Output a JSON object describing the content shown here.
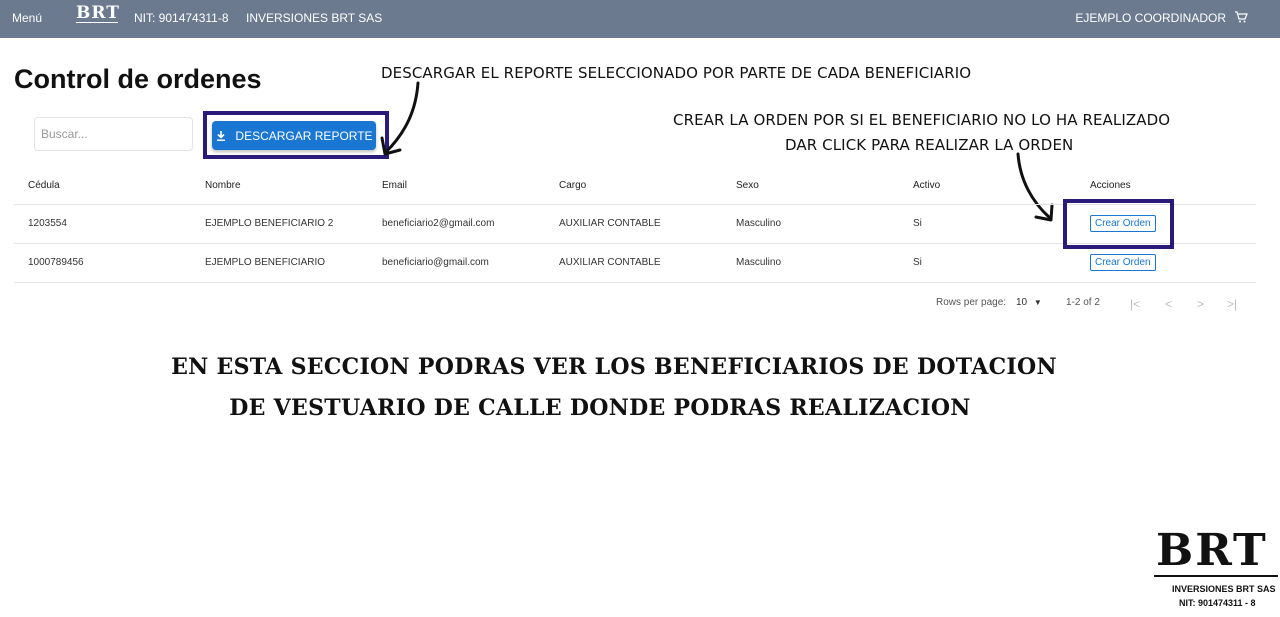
{
  "topbar": {
    "menu_label": "Menú",
    "logo_text": "BRT",
    "nit": "NIT: 901474311-8",
    "company": "INVERSIONES BRT SAS",
    "user": "EJEMPLO COORDINADOR",
    "cart_icon": "cart-icon",
    "background": "#6b7a8f"
  },
  "page": {
    "title": "Control de ordenes"
  },
  "search": {
    "placeholder": "Buscar..."
  },
  "toolbar": {
    "download_label": "DESCARGAR REPORTE",
    "download_icon": "download-icon",
    "accent": "#1976d2"
  },
  "annotations": {
    "download_note": "DESCARGAR EL REPORTE SELECCIONADO POR PARTE DE CADA BENEFICIARIO",
    "create_note_line1": "CREAR LA ORDEN POR SI EL BENEFICIARIO NO LO HA REALIZADO",
    "create_note_line2": "DAR CLICK PARA REALIZAR LA ORDEN",
    "highlight_color": "#2a1a7a"
  },
  "table": {
    "headers": [
      "Cédula",
      "Nombre",
      "Email",
      "Cargo",
      "Sexo",
      "Activo",
      "Acciones"
    ],
    "rows": [
      {
        "cedula": "1203554",
        "nombre": "EJEMPLO BENEFICIARIO 2",
        "email": "beneficiario2@gmail.com",
        "cargo": "AUXILIAR CONTABLE",
        "sexo": "Masculino",
        "activo": "Si",
        "accion": "Crear Orden"
      },
      {
        "cedula": "1000789456",
        "nombre": "EJEMPLO BENEFICIARIO",
        "email": "beneficiario@gmail.com",
        "cargo": "AUXILIAR CONTABLE",
        "sexo": "Masculino",
        "activo": "Si",
        "accion": "Crear Orden"
      }
    ]
  },
  "pagination": {
    "rows_per_page_label": "Rows per page:",
    "rows_per_page_value": "10",
    "range": "1-2 of 2",
    "icons": [
      "first-page-icon",
      "previous-page-icon",
      "next-page-icon",
      "last-page-icon"
    ]
  },
  "overlay": {
    "line1": "EN ESTA SECCION PODRAS VER LOS BENEFICIARIOS DE DOTACION",
    "line2": "DE VESTUARIO DE CALLE  DONDE PODRAS REALIZACION"
  },
  "footer_logo": {
    "logo_text": "BRT",
    "line1": "INVERSIONES BRT SAS",
    "line2": "NIT: 901474311 - 8"
  }
}
